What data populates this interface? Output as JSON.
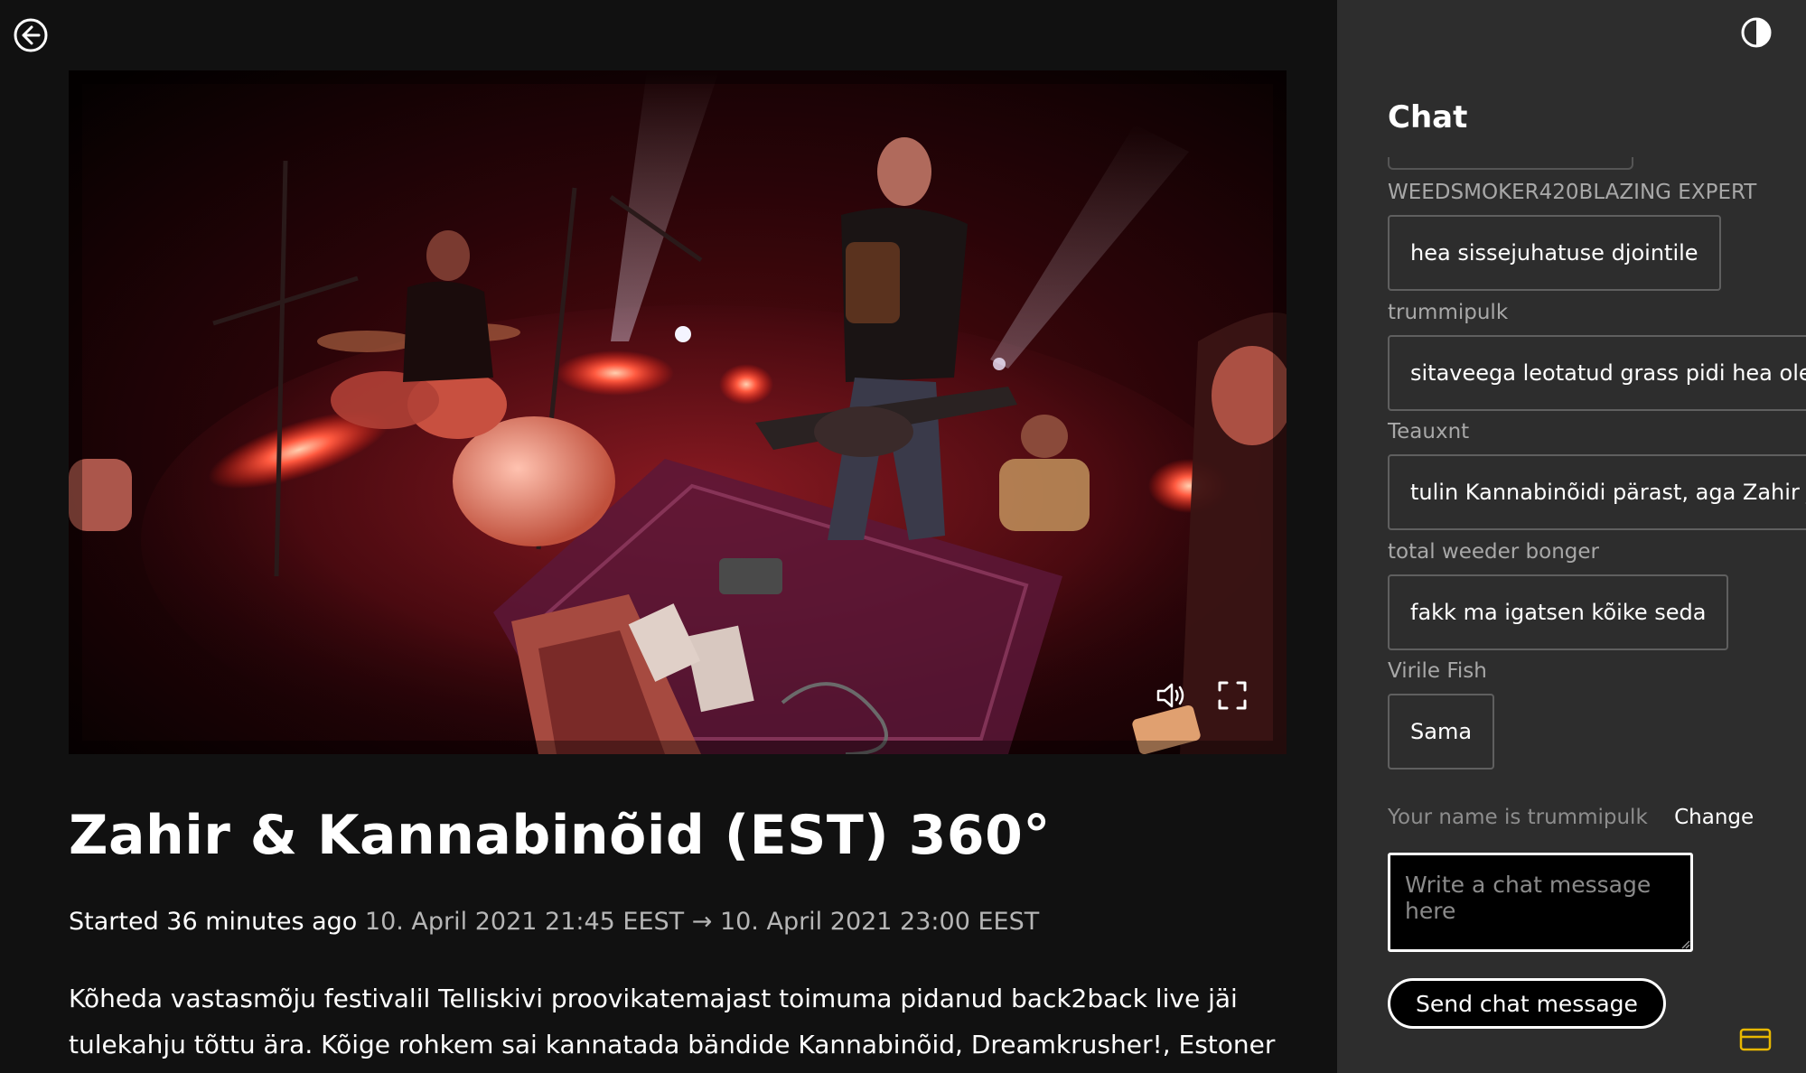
{
  "nav": {
    "back_icon": "arrow-left-circle-icon"
  },
  "video": {
    "volume_icon": "speaker-volume-icon",
    "fullscreen_icon": "fullscreen-icon"
  },
  "event": {
    "title": "Zahir & Kannabinõid (EST) 360°",
    "started": "Started 36 minutes ago",
    "time_range": "10. April 2021 21:45 EEST → 10. April 2021 23:00 EEST",
    "description": "Kõheda vastasmõju festivalil Telliskivi proovikatemajast toimuma pidanud back2back live jäi tulekahju tõttu ära. Kõige rohkem sai kannatada bändide Kannabinõid, Dreamkrusher!, Estoner ja"
  },
  "chat": {
    "title": "Chat",
    "contrast_icon": "contrast-toggle-icon",
    "messages": [
      {
        "author": "WEEDSMOKER420BLAZING EXPERT",
        "text": "hea sissejuhatuse djointile"
      },
      {
        "author": "trummipulk",
        "text": "sitaveega leotatud grass pidi hea olem"
      },
      {
        "author": "Teauxnt",
        "text": "tulin Kannabinõidi pärast, aga Zahir ju"
      },
      {
        "author": "total weeder bonger",
        "text": "fakk ma igatsen kõike seda"
      },
      {
        "author": "Virile Fish",
        "text": "Sama"
      }
    ],
    "your_name": "Your name is trummipulk",
    "change_label": "Change",
    "input_placeholder": "Write a chat message here",
    "input_value": "",
    "send_label": "Send chat message",
    "card_icon": "credit-card-icon",
    "accent_color": "#e8b800"
  }
}
